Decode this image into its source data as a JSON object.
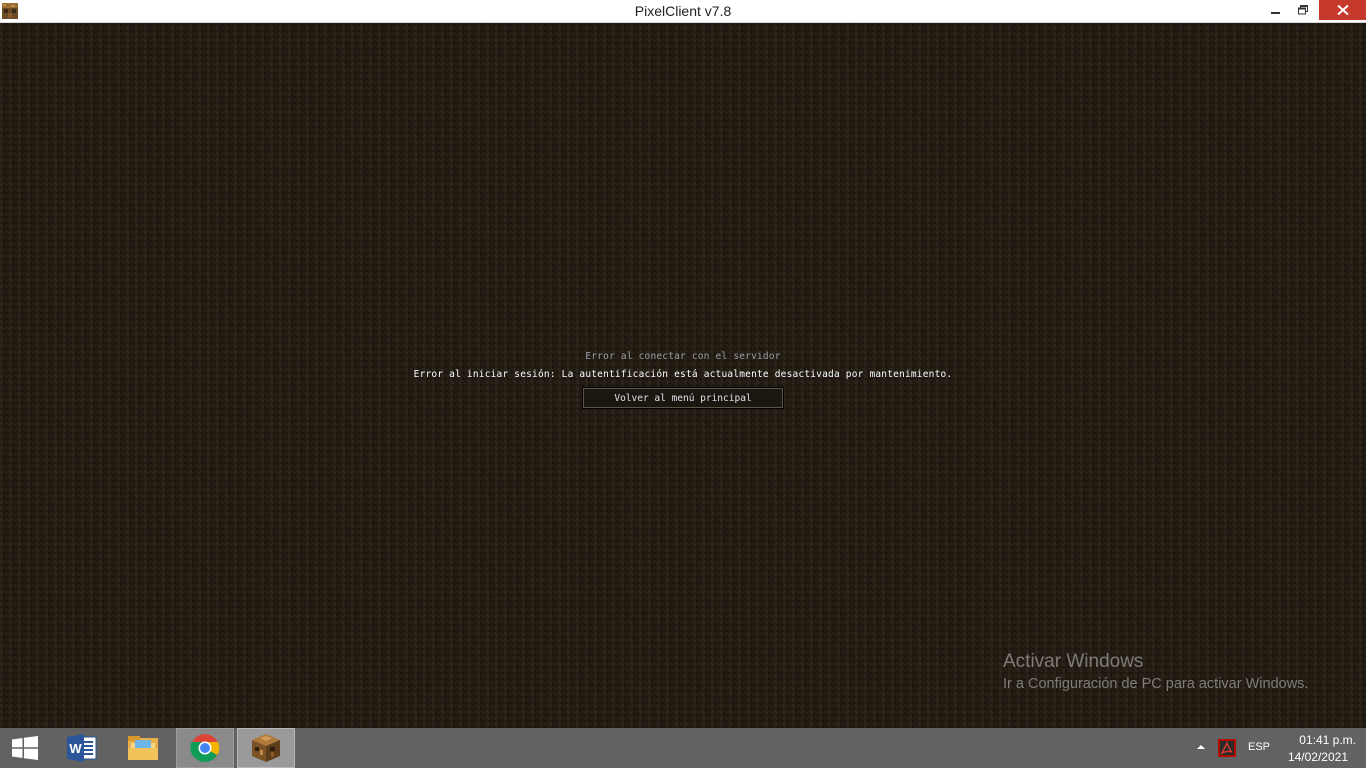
{
  "window": {
    "title": "PixelClient v7.8"
  },
  "screen": {
    "title": "Error al conectar con el servidor",
    "message": "Error al iniciar sesión: La autentificación está actualmente desactivada por mantenimiento.",
    "back_button": "Volver al menú principal"
  },
  "watermark": {
    "title": "Activar Windows",
    "subtitle": "Ir a Configuración de PC para activar Windows."
  },
  "taskbar": {
    "apps": [
      {
        "name": "word",
        "icon": "word-icon"
      },
      {
        "name": "file-explorer",
        "icon": "folder-icon"
      },
      {
        "name": "chrome",
        "icon": "chrome-icon"
      },
      {
        "name": "pixelclient",
        "icon": "crafting-table-icon"
      }
    ],
    "tray": {
      "language": "ESP",
      "time": "01:41 p.m.",
      "date": "14/02/2021"
    }
  },
  "colors": {
    "taskbar": "#626262",
    "close_button": "#c7392a",
    "background": "#221b12"
  }
}
